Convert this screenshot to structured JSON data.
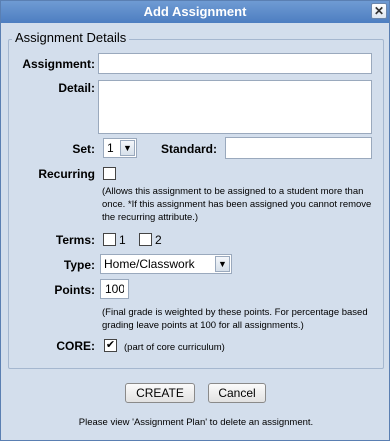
{
  "dialog": {
    "title": "Add Assignment",
    "close_glyph": "✕"
  },
  "group": {
    "legend": "Assignment Details"
  },
  "fields": {
    "assignment_label": "Assignment:",
    "detail_label": "Detail:",
    "set_label": "Set:",
    "set_value": "1",
    "standard_label": "Standard:",
    "recurring_label": "Recurring",
    "recurring_note": "(Allows this assignment to be assigned to a student more than once. *If this assignment has been assigned you cannot remove the recurring attribute.)",
    "terms_label": "Terms:",
    "term1": "1",
    "term2": "2",
    "type_label": "Type:",
    "type_value": "Home/Classwork",
    "points_label": "Points:",
    "points_value": "100",
    "points_note": "(Final grade is weighted by these points. For percentage based grading leave points at 100 for all assignments.)",
    "core_label": "CORE:",
    "core_check": "✔",
    "core_note": "(part of core curriculum)"
  },
  "buttons": {
    "create": "CREATE",
    "cancel": "Cancel"
  },
  "footer": {
    "text": "Please view 'Assignment Plan' to delete an assignment."
  },
  "icons": {
    "dropdown": "chevron-down-icon",
    "close": "close-icon"
  }
}
